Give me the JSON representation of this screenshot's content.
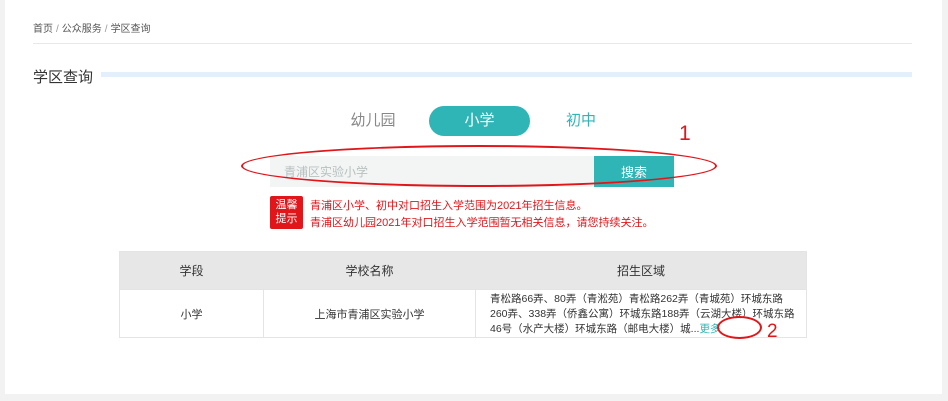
{
  "breadcrumb": {
    "home": "首页",
    "sep": "/",
    "services": "公众服务",
    "current": "学区查询"
  },
  "section": {
    "title": "学区查询"
  },
  "tabs": {
    "kindergarten": "幼儿园",
    "primary": "小学",
    "middle": "初中"
  },
  "search": {
    "placeholder": "青浦区实验小学",
    "button": "搜索"
  },
  "tip": {
    "badge_line1": "温馨",
    "badge_line2": "提示",
    "line1": "青浦区小学、初中对口招生入学范围为2021年招生信息。",
    "line2": "青浦区幼儿园2021年对口招生入学范围暂无相关信息，请您持续关注。"
  },
  "table": {
    "headers": [
      "学段",
      "学校名称",
      "招生区域"
    ],
    "rows": [
      {
        "stage": "小学",
        "school": "上海市青浦区实验小学",
        "area": "青松路66弄、80弄（青淞苑）青松路262弄（青城苑）环城东路260弄、338弄（侨鑫公寓）环城东路188弄（云湖大楼）环城东路46号（水产大楼）环城东路（邮电大楼）城...",
        "more": "更多"
      }
    ]
  },
  "annotations": {
    "one": "1",
    "two": "2"
  },
  "colors": {
    "accent": "#2fb5b5",
    "alert": "#e0161b",
    "header_bg": "#e7e7e7"
  }
}
